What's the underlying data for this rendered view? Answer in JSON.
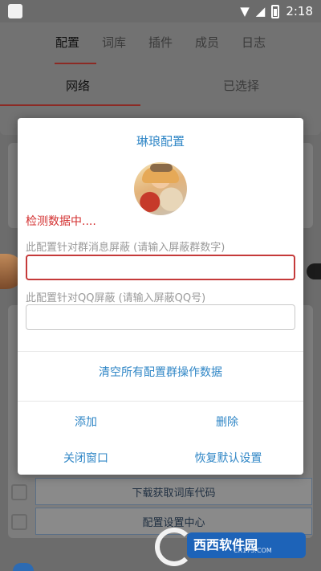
{
  "status_bar": {
    "time": "2:18"
  },
  "app": {
    "tabs": [
      "配置",
      "词库",
      "插件",
      "成员",
      "日志"
    ],
    "sub_tabs": {
      "network": "网络",
      "selected": "已选择"
    },
    "bg_rows": {
      "download_code": "下载获取词库代码",
      "settings_center": "配置设置中心"
    }
  },
  "dialog": {
    "title": "琳琅配置",
    "status": "检测数据中....",
    "group_label": "此配置针对群消息屏蔽 (请输入屏蔽群数字)",
    "group_input_value": "",
    "qq_label": "此配置针对QQ屏蔽 (请输入屏蔽QQ号)",
    "qq_input_value": "",
    "clear_button": "清空所有配置群操作数据",
    "add_button": "添加",
    "delete_button": "删除",
    "close_button": "关闭窗口",
    "restore_button": "恢复默认设置",
    "accent_color": "#2f86c6",
    "status_color": "#d32f2f"
  },
  "watermark": {
    "title": "西西软件园",
    "url": "CR173.COM"
  }
}
